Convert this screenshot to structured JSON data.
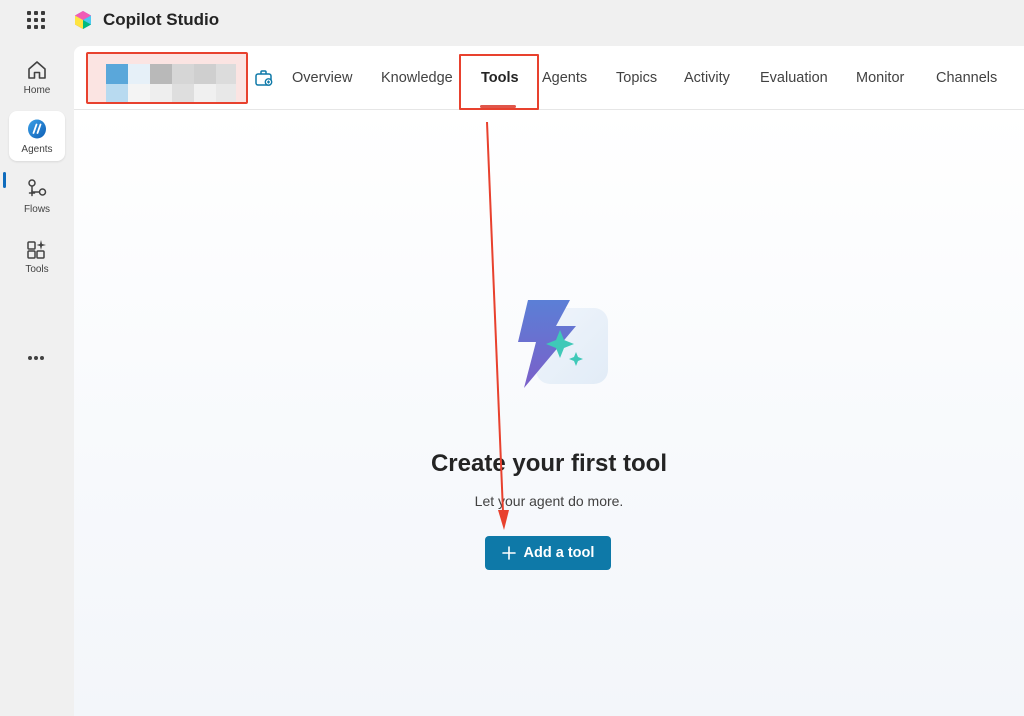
{
  "app": {
    "title": "Copilot Studio"
  },
  "colors": {
    "accent": "#0e79a8",
    "annotation": "#e8412e",
    "tab_underline": "#e0564a"
  },
  "rail": {
    "items": [
      {
        "label": "Home",
        "icon": "home-icon"
      },
      {
        "label": "Agents",
        "icon": "agents-icon",
        "active": true
      },
      {
        "label": "Flows",
        "icon": "flows-icon"
      },
      {
        "label": "Tools",
        "icon": "tools-icon"
      }
    ],
    "more_icon": "more-icon"
  },
  "agent": {
    "name_suffix": "n"
  },
  "tabs": [
    {
      "label": "Overview"
    },
    {
      "label": "Knowledge"
    },
    {
      "label": "Tools",
      "active": true
    },
    {
      "label": "Agents"
    },
    {
      "label": "Topics"
    },
    {
      "label": "Activity"
    },
    {
      "label": "Evaluation"
    },
    {
      "label": "Monitor"
    },
    {
      "label": "Channels"
    }
  ],
  "empty_state": {
    "icon": "lightning-sparkle-icon",
    "title": "Create your first tool",
    "subtitle": "Let your agent do more.",
    "button_label": "Add a tool",
    "button_icon": "plus-icon"
  }
}
